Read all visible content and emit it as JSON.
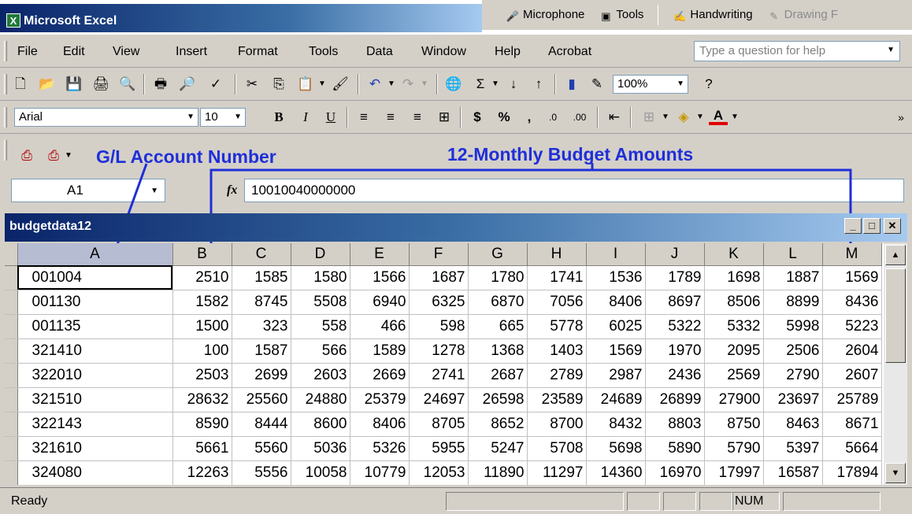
{
  "app": {
    "title": "Microsoft Excel"
  },
  "language_bar": {
    "microphone": "Microphone",
    "tools": "Tools",
    "handwriting": "Handwriting",
    "drawing": "Drawing F"
  },
  "menu": {
    "items": [
      "File",
      "Edit",
      "View",
      "Insert",
      "Format",
      "Tools",
      "Data",
      "Window",
      "Help",
      "Acrobat"
    ],
    "help_placeholder": "Type a question for help"
  },
  "standard_toolbar": {
    "zoom": "100%"
  },
  "formatting_toolbar": {
    "font": "Arial",
    "size": "10"
  },
  "annotations": {
    "account": "G/L Account Number",
    "budget": "12-Monthly Budget Amounts"
  },
  "formula_bar": {
    "name_box": "A1",
    "fx": "fx",
    "formula": "10010040000000"
  },
  "workbook": {
    "title": "budgetdata12"
  },
  "sheet": {
    "columns": [
      "A",
      "B",
      "C",
      "D",
      "E",
      "F",
      "G",
      "H",
      "I",
      "J",
      "K",
      "L",
      "M"
    ],
    "rows": [
      [
        "001004",
        "2510",
        "1585",
        "1580",
        "1566",
        "1687",
        "1780",
        "1741",
        "1536",
        "1789",
        "1698",
        "1887",
        "1569"
      ],
      [
        "001130",
        "1582",
        "8745",
        "5508",
        "6940",
        "6325",
        "6870",
        "7056",
        "8406",
        "8697",
        "8506",
        "8899",
        "8436"
      ],
      [
        "001135",
        "1500",
        "323",
        "558",
        "466",
        "598",
        "665",
        "5778",
        "6025",
        "5322",
        "5332",
        "5998",
        "5223"
      ],
      [
        "321410",
        "100",
        "1587",
        "566",
        "1589",
        "1278",
        "1368",
        "1403",
        "1569",
        "1970",
        "2095",
        "2506",
        "2604"
      ],
      [
        "322010",
        "2503",
        "2699",
        "2603",
        "2669",
        "2741",
        "2687",
        "2789",
        "2987",
        "2436",
        "2569",
        "2790",
        "2607"
      ],
      [
        "321510",
        "28632",
        "25560",
        "24880",
        "25379",
        "24697",
        "26598",
        "23589",
        "24689",
        "26899",
        "27900",
        "23697",
        "25789"
      ],
      [
        "322143",
        "8590",
        "8444",
        "8600",
        "8406",
        "8705",
        "8652",
        "8700",
        "8432",
        "8803",
        "8750",
        "8463",
        "8671"
      ],
      [
        "321610",
        "5661",
        "5560",
        "5036",
        "5326",
        "5955",
        "5247",
        "5708",
        "5698",
        "5890",
        "5790",
        "5397",
        "5664"
      ],
      [
        "324080",
        "12263",
        "5556",
        "10058",
        "10779",
        "12053",
        "11890",
        "11297",
        "14360",
        "16970",
        "17997",
        "16587",
        "17894"
      ]
    ]
  },
  "status": {
    "ready": "Ready",
    "num": "NUM"
  }
}
